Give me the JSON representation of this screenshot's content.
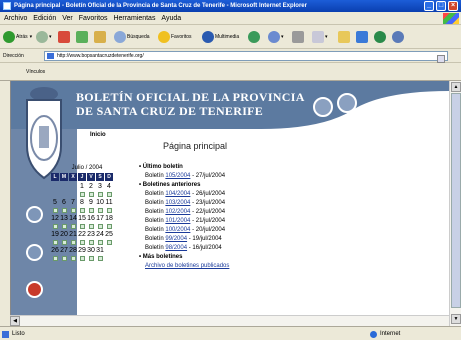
{
  "window": {
    "title": "Página principal - Boletín Oficial de la Provincia de Santa Cruz de Tenerife - Microsoft Internet Explorer"
  },
  "menu": [
    "Archivo",
    "Edición",
    "Ver",
    "Favoritos",
    "Herramientas",
    "Ayuda"
  ],
  "toolbar": {
    "back": "Atrás",
    "search": "Búsqueda",
    "favorites": "Favoritos",
    "media": "Multimedia"
  },
  "address": {
    "label": "Dirección",
    "url": "http://www.bopsantacruzdetenerife.org/"
  },
  "links": {
    "label": "Vínculos"
  },
  "banner": {
    "line1": "BOLETÍN OFICIAL DE LA PROVINCIA",
    "line2": "DE SANTA CRUZ DE TENERIFE"
  },
  "breadcrumb": "Inicio",
  "page_title": "Página principal",
  "calendar": {
    "month": "Julio / 2004",
    "days": [
      "L",
      "M",
      "X",
      "J",
      "V",
      "S",
      "D"
    ],
    "weeks": [
      [
        "",
        "",
        "",
        "1",
        "2",
        "3",
        "4"
      ],
      [
        "5",
        "6",
        "7",
        "8",
        "9",
        "10",
        "11"
      ],
      [
        "12",
        "13",
        "14",
        "15",
        "16",
        "17",
        "18"
      ],
      [
        "19",
        "20",
        "21",
        "22",
        "23",
        "24",
        "25"
      ],
      [
        "26",
        "27",
        "28",
        "29",
        "30",
        "31",
        ""
      ]
    ]
  },
  "bulletins": {
    "latest_heading": "Último boletín",
    "prefix": "Boletín",
    "latest": {
      "number": "105/2004",
      "date": "- 27/jul/2004"
    },
    "previous_heading": "Boletines anteriores",
    "previous": [
      {
        "number": "104/2004",
        "date": "- 26/jul/2004"
      },
      {
        "number": "103/2004",
        "date": "- 23/jul/2004"
      },
      {
        "number": "102/2004",
        "date": "- 22/jul/2004"
      },
      {
        "number": "101/2004",
        "date": "- 21/jul/2004"
      },
      {
        "number": "100/2004",
        "date": "- 20/jul/2004"
      },
      {
        "number": "99/2004",
        "date": "- 19/jul/2004"
      },
      {
        "number": "98/2004",
        "date": "- 16/jul/2004"
      }
    ],
    "more_heading": "Más boletines",
    "archive_link": "Archivo de boletines publicados"
  },
  "status": {
    "text": "Listo",
    "zone": "Internet"
  },
  "colors": {
    "banner": "#5c7aa0",
    "sidebar": "#6e86a8",
    "link": "#1a3a9a",
    "calendar_head": "#1a2a6a"
  }
}
